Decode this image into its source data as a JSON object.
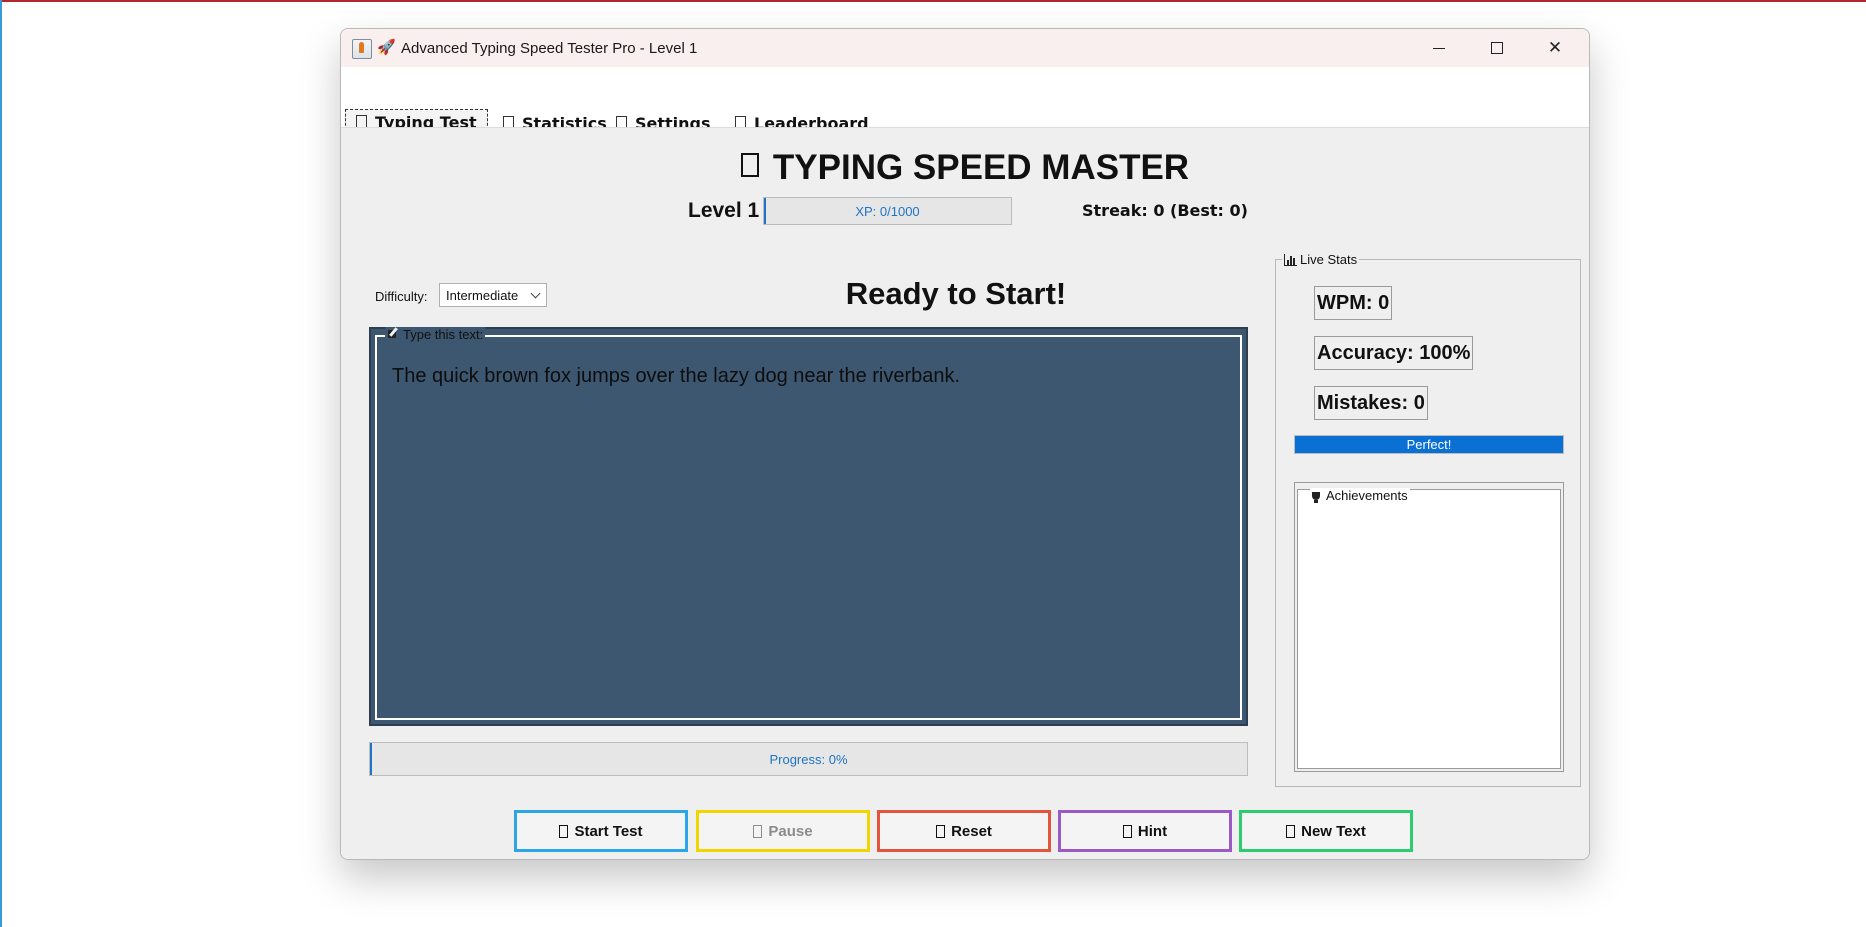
{
  "window": {
    "title": "Advanced Typing Speed Tester Pro - Level 1"
  },
  "tabs": [
    {
      "label": "Typing Test",
      "active": true
    },
    {
      "label": "Statistics",
      "active": false
    },
    {
      "label": "Settings",
      "active": false
    },
    {
      "label": "Leaderboard",
      "active": false
    }
  ],
  "header": {
    "title": "TYPING SPEED MASTER",
    "level_label": "Level 1",
    "xp_text": "XP: 0/1000",
    "xp_fraction": 0,
    "streak_text": "Streak: 0 (Best: 0)"
  },
  "controls": {
    "difficulty_label": "Difficulty:",
    "difficulty_value": "Intermediate",
    "status_text": "Ready to Start!"
  },
  "text_panel": {
    "legend": "Type this text:",
    "sample_text": "The quick brown fox jumps over the lazy dog near the riverbank."
  },
  "progress": {
    "text": "Progress: 0%",
    "fraction": 0
  },
  "buttons": {
    "start": "Start Test",
    "pause": "Pause",
    "reset": "Reset",
    "hint": "Hint",
    "new_text": "New Text"
  },
  "live_stats": {
    "legend": "Live Stats",
    "wpm": "WPM: 0",
    "accuracy": "Accuracy: 100%",
    "mistakes": "Mistakes: 0",
    "accuracy_bar_text": "Perfect!",
    "accuracy_bar_fraction": 1.0,
    "achievements_legend": "Achievements"
  },
  "colors": {
    "text_panel_bg": "#3d5770",
    "accent_blue": "#1f74c4",
    "start_border": "#2ca6e8",
    "pause_border": "#f0d500",
    "reset_border": "#e2553c",
    "hint_border": "#9b59c6",
    "new_text_border": "#2ecc71"
  }
}
